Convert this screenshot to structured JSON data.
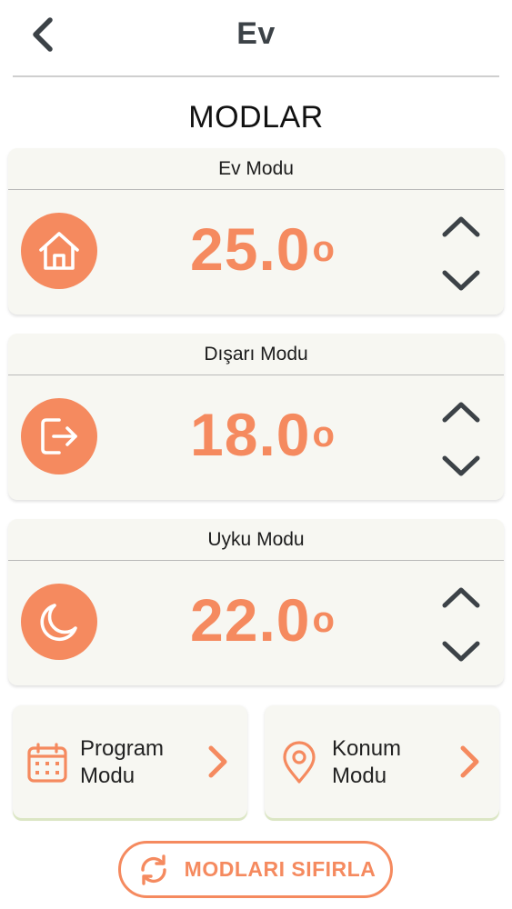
{
  "header": {
    "title": "Ev",
    "back_icon": "chevron-left-icon"
  },
  "section_title": "MODLAR",
  "colors": {
    "accent": "#f58a5f",
    "card_bg": "#f7f7f2",
    "dark": "#3c4247"
  },
  "modes": [
    {
      "label": "Ev Modu",
      "temperature": "25.0",
      "degree": "o",
      "icon": "home-icon"
    },
    {
      "label": "Dışarı Modu",
      "temperature": "18.0",
      "degree": "o",
      "icon": "exit-icon"
    },
    {
      "label": "Uyku Modu",
      "temperature": "22.0",
      "degree": "o",
      "icon": "moon-icon"
    }
  ],
  "nav_cards": [
    {
      "line1": "Program",
      "line2": "Modu",
      "icon": "calendar-icon"
    },
    {
      "line1": "Konum",
      "line2": "Modu",
      "icon": "location-pin-icon"
    }
  ],
  "reset_button": {
    "label": "MODLARI SIFIRLA",
    "icon": "refresh-icon"
  }
}
